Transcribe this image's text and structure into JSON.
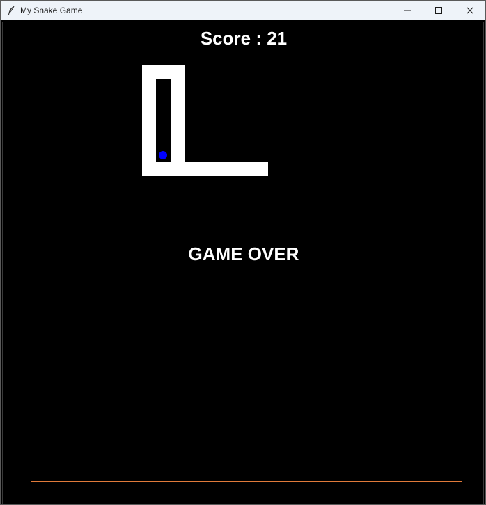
{
  "window": {
    "title": "My Snake Game",
    "icon": "feather-icon"
  },
  "game": {
    "score_text": "Score : 21",
    "status_text": "GAME OVER",
    "snake_color": "#ffffff",
    "food_color": "#0000ff",
    "border_color": "#e07a3a",
    "background_color": "#000000"
  }
}
